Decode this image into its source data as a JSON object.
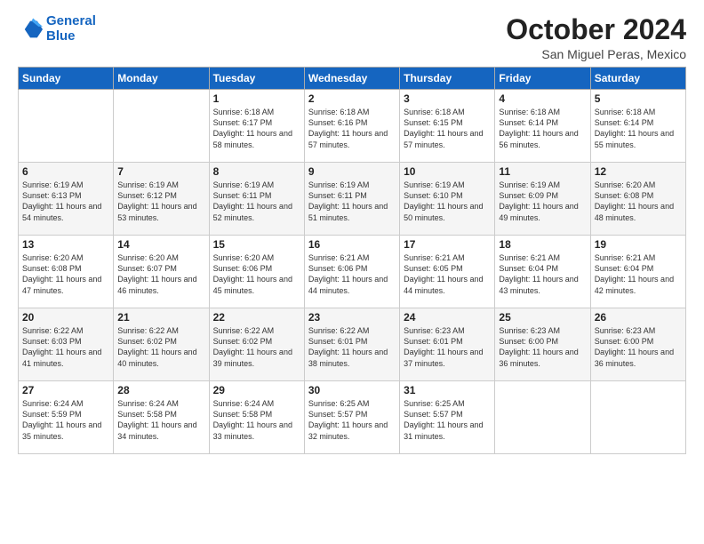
{
  "logo": {
    "line1": "General",
    "line2": "Blue"
  },
  "header": {
    "month": "October 2024",
    "location": "San Miguel Peras, Mexico"
  },
  "days_of_week": [
    "Sunday",
    "Monday",
    "Tuesday",
    "Wednesday",
    "Thursday",
    "Friday",
    "Saturday"
  ],
  "weeks": [
    [
      {
        "day": "",
        "text": ""
      },
      {
        "day": "",
        "text": ""
      },
      {
        "day": "1",
        "text": "Sunrise: 6:18 AM\nSunset: 6:17 PM\nDaylight: 11 hours and 58 minutes."
      },
      {
        "day": "2",
        "text": "Sunrise: 6:18 AM\nSunset: 6:16 PM\nDaylight: 11 hours and 57 minutes."
      },
      {
        "day": "3",
        "text": "Sunrise: 6:18 AM\nSunset: 6:15 PM\nDaylight: 11 hours and 57 minutes."
      },
      {
        "day": "4",
        "text": "Sunrise: 6:18 AM\nSunset: 6:14 PM\nDaylight: 11 hours and 56 minutes."
      },
      {
        "day": "5",
        "text": "Sunrise: 6:18 AM\nSunset: 6:14 PM\nDaylight: 11 hours and 55 minutes."
      }
    ],
    [
      {
        "day": "6",
        "text": "Sunrise: 6:19 AM\nSunset: 6:13 PM\nDaylight: 11 hours and 54 minutes."
      },
      {
        "day": "7",
        "text": "Sunrise: 6:19 AM\nSunset: 6:12 PM\nDaylight: 11 hours and 53 minutes."
      },
      {
        "day": "8",
        "text": "Sunrise: 6:19 AM\nSunset: 6:11 PM\nDaylight: 11 hours and 52 minutes."
      },
      {
        "day": "9",
        "text": "Sunrise: 6:19 AM\nSunset: 6:11 PM\nDaylight: 11 hours and 51 minutes."
      },
      {
        "day": "10",
        "text": "Sunrise: 6:19 AM\nSunset: 6:10 PM\nDaylight: 11 hours and 50 minutes."
      },
      {
        "day": "11",
        "text": "Sunrise: 6:19 AM\nSunset: 6:09 PM\nDaylight: 11 hours and 49 minutes."
      },
      {
        "day": "12",
        "text": "Sunrise: 6:20 AM\nSunset: 6:08 PM\nDaylight: 11 hours and 48 minutes."
      }
    ],
    [
      {
        "day": "13",
        "text": "Sunrise: 6:20 AM\nSunset: 6:08 PM\nDaylight: 11 hours and 47 minutes."
      },
      {
        "day": "14",
        "text": "Sunrise: 6:20 AM\nSunset: 6:07 PM\nDaylight: 11 hours and 46 minutes."
      },
      {
        "day": "15",
        "text": "Sunrise: 6:20 AM\nSunset: 6:06 PM\nDaylight: 11 hours and 45 minutes."
      },
      {
        "day": "16",
        "text": "Sunrise: 6:21 AM\nSunset: 6:06 PM\nDaylight: 11 hours and 44 minutes."
      },
      {
        "day": "17",
        "text": "Sunrise: 6:21 AM\nSunset: 6:05 PM\nDaylight: 11 hours and 44 minutes."
      },
      {
        "day": "18",
        "text": "Sunrise: 6:21 AM\nSunset: 6:04 PM\nDaylight: 11 hours and 43 minutes."
      },
      {
        "day": "19",
        "text": "Sunrise: 6:21 AM\nSunset: 6:04 PM\nDaylight: 11 hours and 42 minutes."
      }
    ],
    [
      {
        "day": "20",
        "text": "Sunrise: 6:22 AM\nSunset: 6:03 PM\nDaylight: 11 hours and 41 minutes."
      },
      {
        "day": "21",
        "text": "Sunrise: 6:22 AM\nSunset: 6:02 PM\nDaylight: 11 hours and 40 minutes."
      },
      {
        "day": "22",
        "text": "Sunrise: 6:22 AM\nSunset: 6:02 PM\nDaylight: 11 hours and 39 minutes."
      },
      {
        "day": "23",
        "text": "Sunrise: 6:22 AM\nSunset: 6:01 PM\nDaylight: 11 hours and 38 minutes."
      },
      {
        "day": "24",
        "text": "Sunrise: 6:23 AM\nSunset: 6:01 PM\nDaylight: 11 hours and 37 minutes."
      },
      {
        "day": "25",
        "text": "Sunrise: 6:23 AM\nSunset: 6:00 PM\nDaylight: 11 hours and 36 minutes."
      },
      {
        "day": "26",
        "text": "Sunrise: 6:23 AM\nSunset: 6:00 PM\nDaylight: 11 hours and 36 minutes."
      }
    ],
    [
      {
        "day": "27",
        "text": "Sunrise: 6:24 AM\nSunset: 5:59 PM\nDaylight: 11 hours and 35 minutes."
      },
      {
        "day": "28",
        "text": "Sunrise: 6:24 AM\nSunset: 5:58 PM\nDaylight: 11 hours and 34 minutes."
      },
      {
        "day": "29",
        "text": "Sunrise: 6:24 AM\nSunset: 5:58 PM\nDaylight: 11 hours and 33 minutes."
      },
      {
        "day": "30",
        "text": "Sunrise: 6:25 AM\nSunset: 5:57 PM\nDaylight: 11 hours and 32 minutes."
      },
      {
        "day": "31",
        "text": "Sunrise: 6:25 AM\nSunset: 5:57 PM\nDaylight: 11 hours and 31 minutes."
      },
      {
        "day": "",
        "text": ""
      },
      {
        "day": "",
        "text": ""
      }
    ]
  ]
}
